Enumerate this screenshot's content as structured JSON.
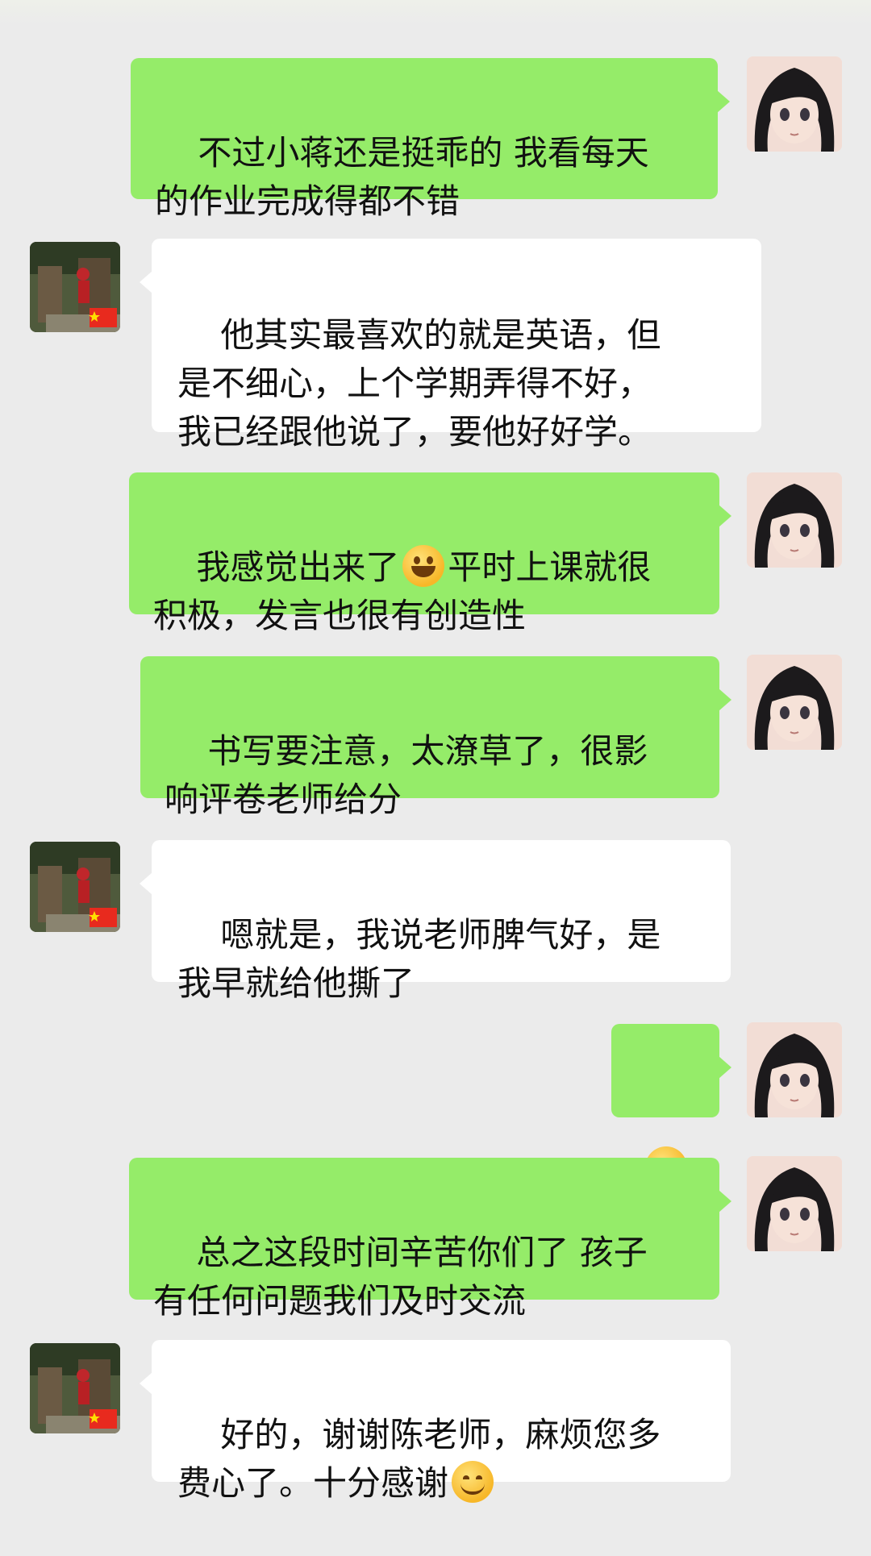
{
  "chat": {
    "messages": [
      {
        "sender": "me",
        "avatar": "anime-girl-avatar",
        "text": "不过小蒋还是挺乖的 我看每天\n的作业完成得都不错"
      },
      {
        "sender": "them",
        "avatar": "parent-photo-avatar",
        "text": "他其实最喜欢的就是英语，但\n是不细心，上个学期弄得不好，\n我已经跟他说了，要他好好学。"
      },
      {
        "sender": "me",
        "avatar": "anime-girl-avatar",
        "text_before": "我感觉出来了",
        "emoji": "grinning-face",
        "text_after": "平时上课就很\n积极，发言也很有创造性"
      },
      {
        "sender": "me",
        "avatar": "anime-girl-avatar",
        "text": "书写要注意，太潦草了，很影\n响评卷老师给分"
      },
      {
        "sender": "them",
        "avatar": "parent-photo-avatar",
        "text": "嗯就是，我说老师脾气好，是\n我早就给他撕了"
      },
      {
        "sender": "me",
        "avatar": "anime-girl-avatar",
        "emoji": "tears-of-joy-face"
      },
      {
        "sender": "me",
        "avatar": "anime-girl-avatar",
        "text": "总之这段时间辛苦你们了 孩子\n有任何问题我们及时交流"
      },
      {
        "sender": "them",
        "avatar": "parent-photo-avatar",
        "text_before": "好的，谢谢陈老师，麻烦您多\n费心了。十分感谢",
        "emoji": "smiling-face"
      }
    ]
  },
  "colors": {
    "background": "#ebebeb",
    "my_bubble": "#95ec69",
    "their_bubble": "#ffffff",
    "text": "#111111"
  }
}
